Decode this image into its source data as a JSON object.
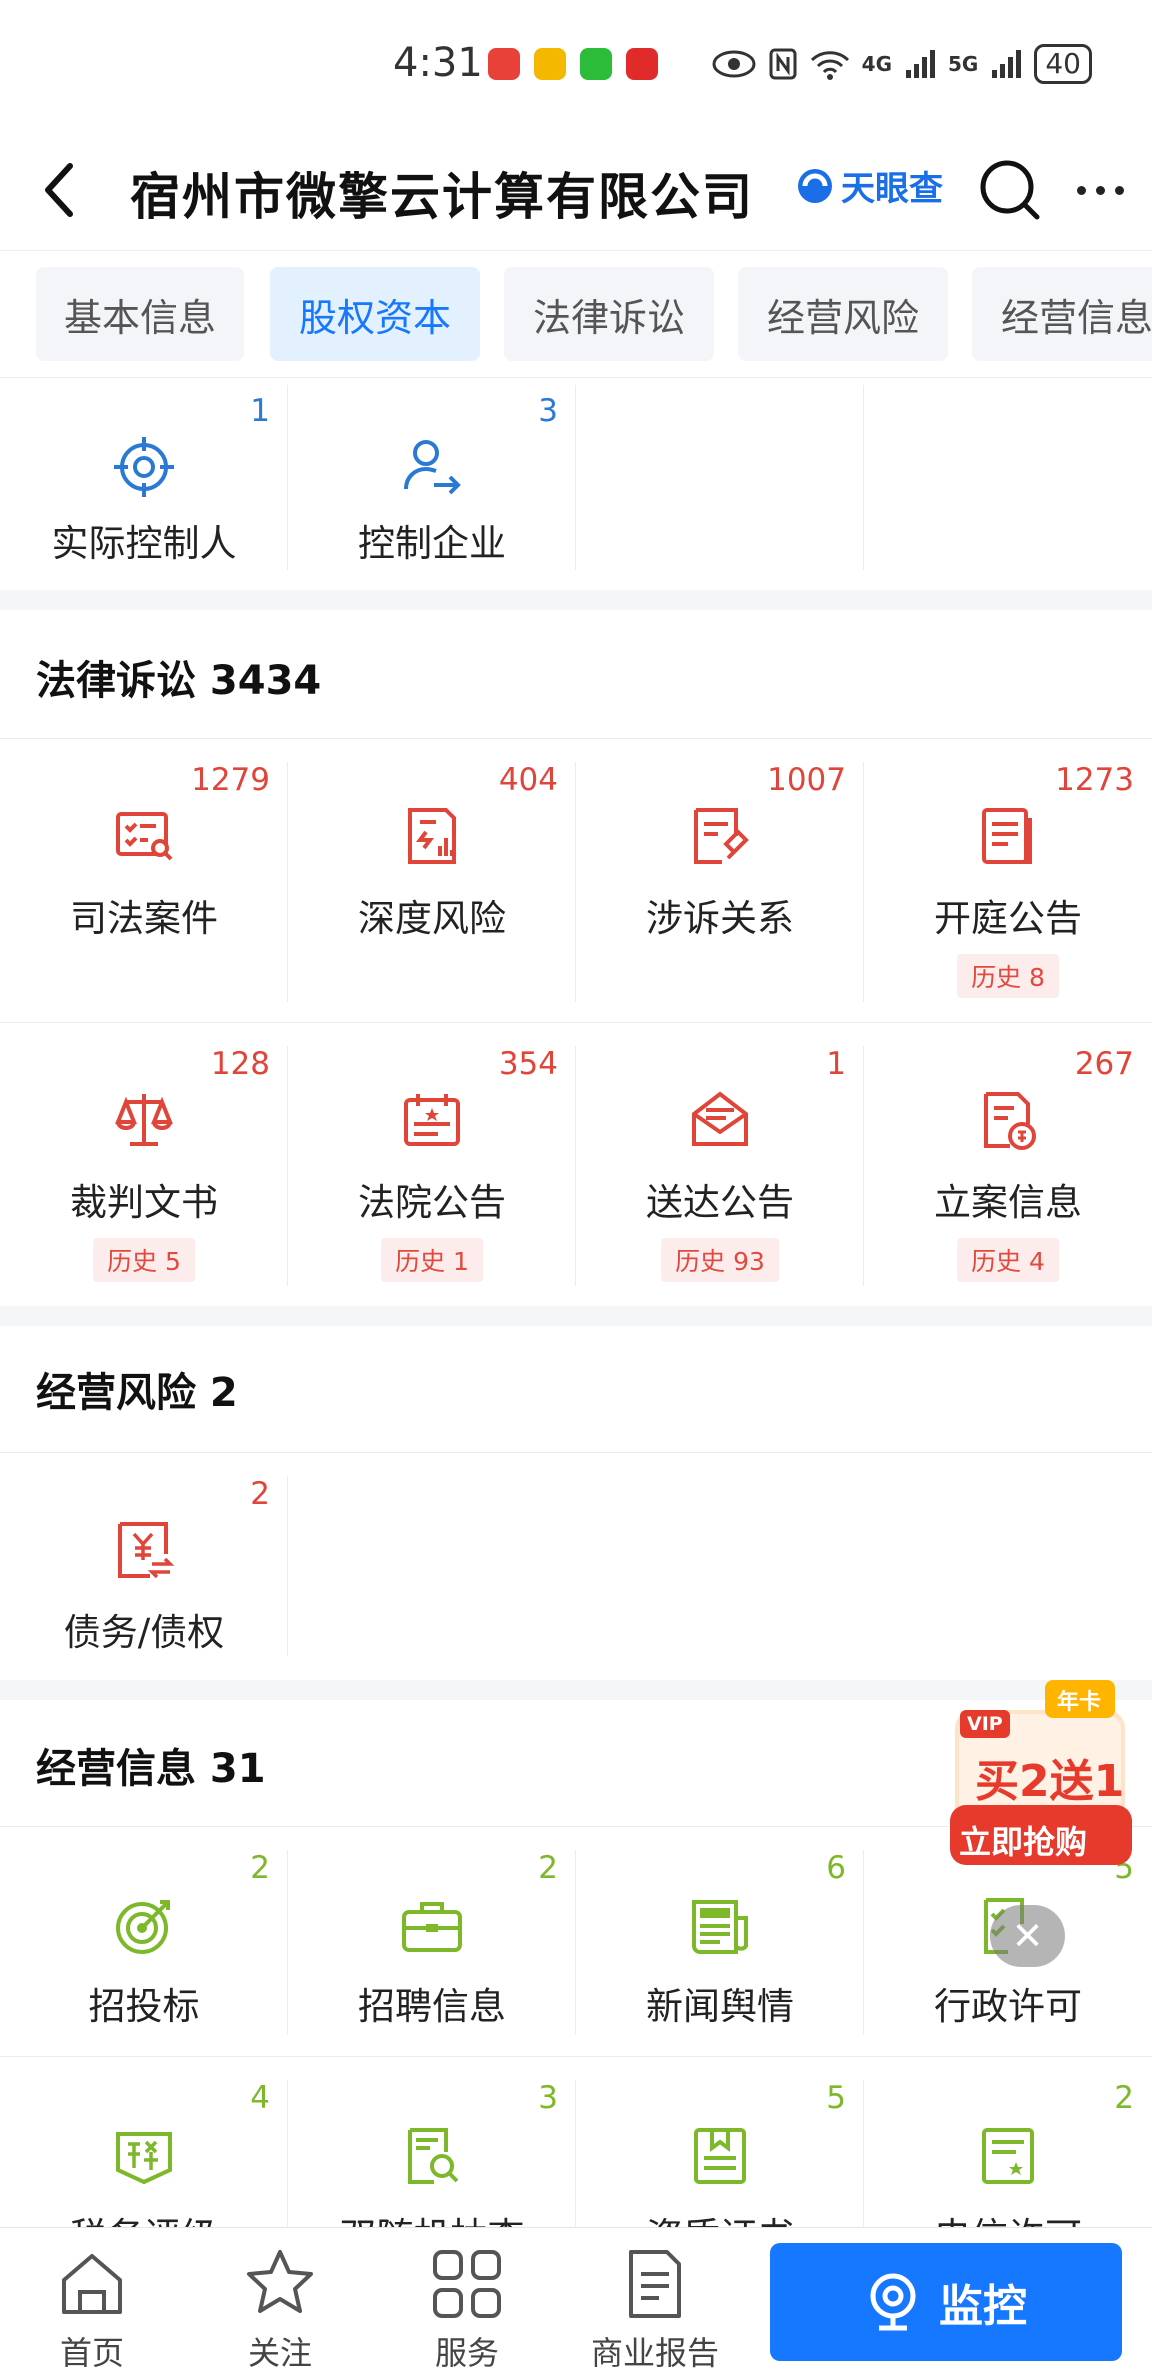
{
  "status_bar": {
    "time": "4:31",
    "battery": "40",
    "signal1": "4G",
    "signal2": "5G"
  },
  "header": {
    "title": "宿州市微擎云计算有限公司",
    "brand": "天眼查"
  },
  "tabs": [
    {
      "label": "基本信息"
    },
    {
      "label": "股权资本"
    },
    {
      "label": "法律诉讼"
    },
    {
      "label": "经营风险"
    },
    {
      "label": "经营信息"
    }
  ],
  "equity_items": [
    {
      "label": "实际控制人",
      "count": "1",
      "icon": "target-icon"
    },
    {
      "label": "控制企业",
      "count": "3",
      "icon": "user-transfer-icon"
    }
  ],
  "legal": {
    "title": "法律诉讼 3434",
    "items": [
      {
        "label": "司法案件",
        "count": "1279",
        "icon": "case-search-icon"
      },
      {
        "label": "深度风险",
        "count": "404",
        "icon": "risk-chart-icon"
      },
      {
        "label": "涉诉关系",
        "count": "1007",
        "icon": "litigation-icon"
      },
      {
        "label": "开庭公告",
        "count": "1273",
        "icon": "court-notice-icon",
        "history": "历史 8"
      },
      {
        "label": "裁判文书",
        "count": "128",
        "icon": "scales-icon",
        "history": "历史 5"
      },
      {
        "label": "法院公告",
        "count": "354",
        "icon": "calendar-star-icon",
        "history": "历史 1"
      },
      {
        "label": "送达公告",
        "count": "1",
        "icon": "envelope-icon",
        "history": "历史 93"
      },
      {
        "label": "立案信息",
        "count": "267",
        "icon": "filing-icon",
        "history": "历史 4"
      }
    ]
  },
  "operation_risk": {
    "title": "经营风险 2",
    "items": [
      {
        "label": "债务/债权",
        "count": "2",
        "icon": "debt-icon"
      }
    ]
  },
  "operation_info": {
    "title": "经营信息 31",
    "items": [
      {
        "label": "招投标",
        "count": "2",
        "icon": "bid-target-icon"
      },
      {
        "label": "招聘信息",
        "count": "2",
        "icon": "briefcase-icon"
      },
      {
        "label": "新闻舆情",
        "count": "6",
        "icon": "news-icon"
      },
      {
        "label": "行政许可",
        "count": "5",
        "icon": "permit-icon"
      },
      {
        "label": "税务评级",
        "count": "4",
        "icon": "tax-icon"
      },
      {
        "label": "双随机抽查",
        "count": "3",
        "icon": "inspection-icon"
      },
      {
        "label": "资质证书",
        "count": "5",
        "icon": "certificate-icon"
      },
      {
        "label": "电信许可",
        "count": "2",
        "icon": "telecom-permit-icon"
      }
    ]
  },
  "promo": {
    "badge_top": "年卡",
    "badge_vip": "VIP",
    "headline": "买2送1",
    "cta": "立即抢购"
  },
  "bottom_nav": [
    {
      "label": "首页",
      "icon": "home-icon"
    },
    {
      "label": "关注",
      "icon": "star-icon"
    },
    {
      "label": "服务",
      "icon": "grid-icon"
    },
    {
      "label": "商业报告",
      "icon": "report-icon"
    }
  ],
  "monitor_button": {
    "label": "监控"
  },
  "colors": {
    "accent": "#1677ff",
    "legal_red": "#e0453a",
    "equity_blue": "#2a7ad5",
    "info_green": "#7cb82a"
  }
}
